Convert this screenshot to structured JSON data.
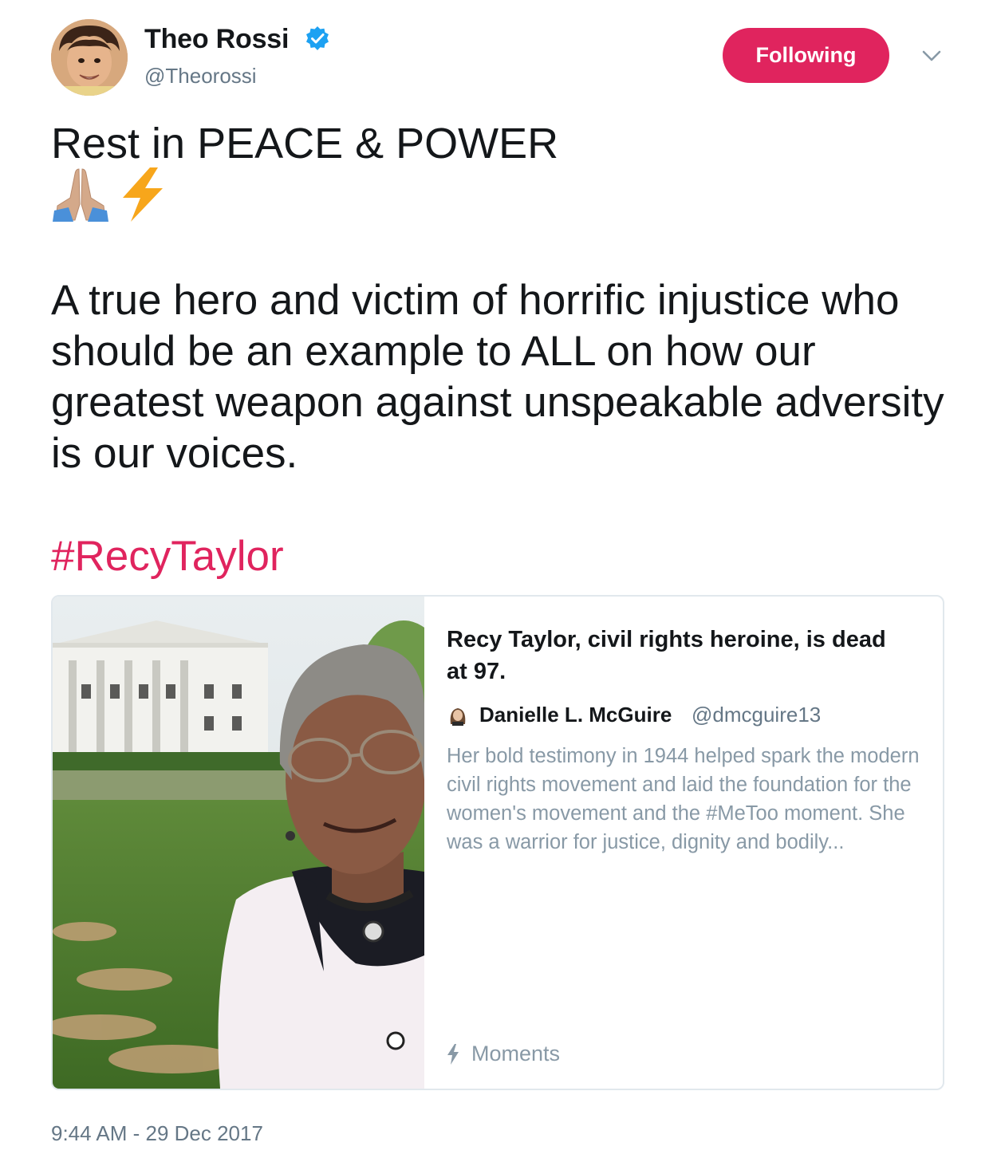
{
  "author": {
    "display_name": "Theo Rossi",
    "handle": "@Theorossi",
    "verified": true,
    "avatar": "profile-photo"
  },
  "follow_button": {
    "label": "Following",
    "color": "#e0245e"
  },
  "menu": {
    "icon": "chevron-down-icon"
  },
  "tweet": {
    "line1": "Rest in PEACE & POWER",
    "emojis": [
      "folded-hands-emoji",
      "lightning-emoji"
    ],
    "body": "A true hero and victim of horrific injustice who should be an example to ALL on how our greatest weapon against unspeakable adversity is our voices.",
    "hashtag": "#RecyTaylor",
    "hashtag_color": "#e0245e"
  },
  "card": {
    "image": "recy-taylor-white-house-photo",
    "title": "Recy Taylor, civil rights heroine, is dead at 97.",
    "author_name": "Danielle L. McGuire",
    "author_handle": "@dmcguire13",
    "description": "Her bold testimony in 1944 helped spark the modern civil rights movement and laid the foundation for the women's movement and the #MeToo moment. She was a warrior for justice, dignity and bodily...",
    "footer_icon": "lightning-icon",
    "footer_label": "Moments"
  },
  "timestamp": "9:44 AM - 29 Dec 2017"
}
